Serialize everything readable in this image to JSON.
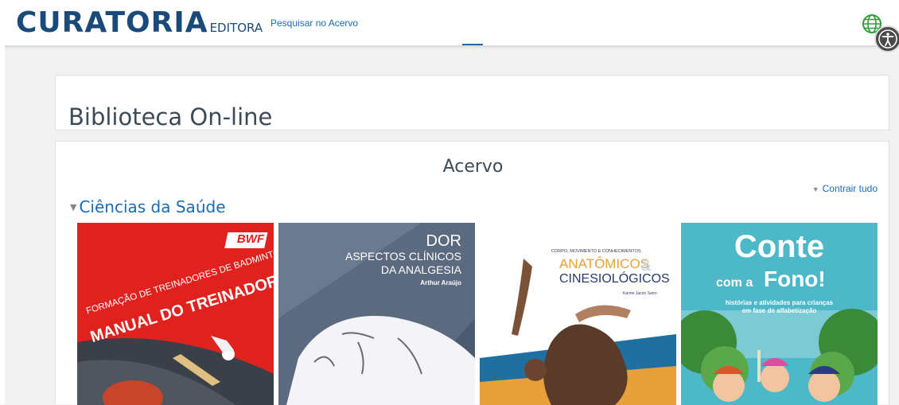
{
  "header": {
    "logo_main": "CURATORIA",
    "logo_sub": "EDITORA",
    "nav_link": "Pesquisar no Acervo"
  },
  "page": {
    "title": "Biblioteca On-line"
  },
  "collection": {
    "title": "Acervo",
    "collapse_label": "Contrair tudo",
    "category": "Ciências da Saúde",
    "books": [
      {
        "badge": "BWF",
        "line1": "FORMAÇÃO DE TREINADORES DE BADMINTON",
        "line2": "MANUAL DO TREINADOR"
      },
      {
        "line1": "DOR",
        "line2": "ASPECTOS CLÍNICOS",
        "line3": "DA ANALGESIA",
        "author": "Arthur Araújo"
      },
      {
        "small": "CORPO, MOVIMENTO E CONHECIMENTOS",
        "line1": "ANATÔMICOS",
        "amp": "&",
        "line2": "CINESIOLÓGICOS",
        "author": "Karine Jacon Sarro"
      },
      {
        "line1": "Conte",
        "line2a": "com a",
        "line2b": "Fono!",
        "sub1": "histórias e atividades para crianças",
        "sub2": "em fase de alfabetização"
      }
    ]
  },
  "colors": {
    "brand": "#1a4a7a",
    "link": "#1a6bb5",
    "globe": "#2e9e3a"
  }
}
